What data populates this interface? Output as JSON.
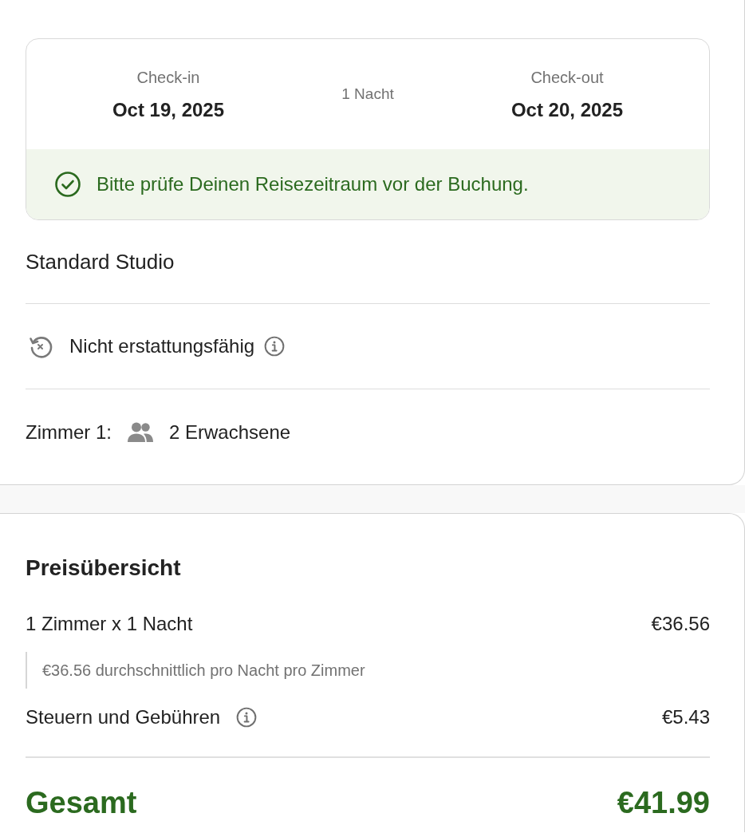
{
  "stay": {
    "check_in": {
      "label": "Check-in",
      "date": "Oct 19, 2025"
    },
    "nights": "1 Nacht",
    "check_out": {
      "label": "Check-out",
      "date": "Oct 20, 2025"
    },
    "notice": "Bitte prüfe Deinen Reisezeitraum vor der Buchung."
  },
  "room": {
    "name": "Standard Studio",
    "policy": "Nicht erstattungsfähig",
    "policy_info": true,
    "occupancy_label": "Zimmer 1:",
    "guests": "2 Erwachsene"
  },
  "price_summary": {
    "title": "Preisübersicht",
    "lines": [
      {
        "label": "1 Zimmer x 1 Nacht",
        "info": false,
        "amount": "€36.56",
        "note": "€36.56 durchschnittlich pro Nacht pro Zimmer"
      },
      {
        "label": "Steuern und Gebühren",
        "info": true,
        "amount": "€5.43"
      }
    ],
    "total": {
      "label": "Gesamt",
      "amount": "€41.99"
    }
  }
}
